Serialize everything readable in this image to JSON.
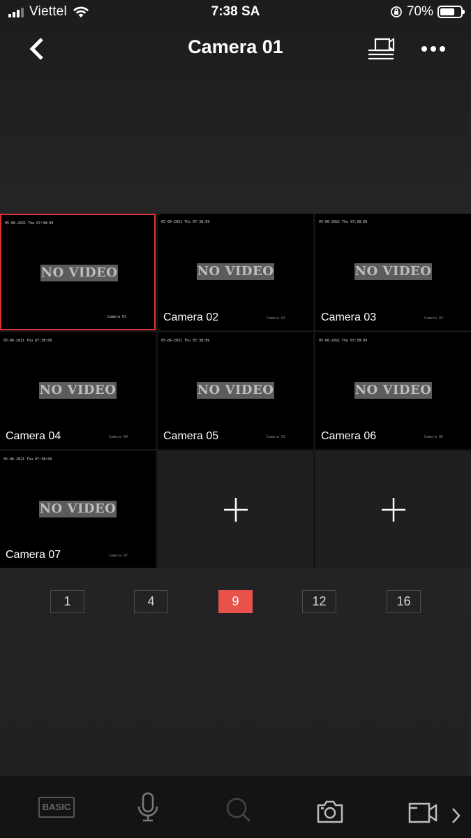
{
  "status_bar": {
    "carrier": "Viettel",
    "time": "7:38 SA",
    "battery": "70%",
    "battery_level": 0.7
  },
  "header": {
    "title": "Camera 01",
    "back_icon": "chevron-left-icon",
    "multiview_icon": "multi-screen-icon",
    "more_icon": "ellipsis-icon"
  },
  "grid": {
    "tiles": [
      {
        "label": "",
        "no_video": "NO VIDEO",
        "osd_time": "05-06-2021 Thu 07:38:09",
        "osd_name": "Camera 01",
        "selected": true
      },
      {
        "label": "Camera 02",
        "no_video": "NO VIDEO",
        "osd_time": "05-06-2021 Thu 07:38:09",
        "osd_name": "Camera 02"
      },
      {
        "label": "Camera 03",
        "no_video": "NO VIDEO",
        "osd_time": "05-06-2021 Thu 07:38:09",
        "osd_name": "Camera 03"
      },
      {
        "label": "Camera 04",
        "no_video": "NO VIDEO",
        "osd_time": "05-06-2021 Thu 07:38:09",
        "osd_name": "Camera 04"
      },
      {
        "label": "Camera 05",
        "no_video": "NO VIDEO",
        "osd_time": "05-06-2021 Thu 07:38:09",
        "osd_name": "Camera 05"
      },
      {
        "label": "Camera 06",
        "no_video": "NO VIDEO",
        "osd_time": "05-06-2021 Thu 07:38:09",
        "osd_name": "Camera 06"
      },
      {
        "label": "Camera 07",
        "no_video": "NO VIDEO",
        "osd_time": "05-06-2021 Thu 07:38:09",
        "osd_name": "Camera 07"
      }
    ],
    "empty_slot_icon": "plus-icon"
  },
  "splits": {
    "options": [
      "1",
      "4",
      "9",
      "12",
      "16"
    ],
    "active": "9"
  },
  "toolbar": {
    "basic_label": "BASIC",
    "mic_icon": "microphone-icon",
    "zoom_icon": "magnifier-icon",
    "snapshot_icon": "camera-icon",
    "record_icon": "video-record-icon",
    "next_icon": "chevron-right-icon"
  },
  "colors": {
    "accent": "#e8524a",
    "selected_border": "#d9342b"
  }
}
